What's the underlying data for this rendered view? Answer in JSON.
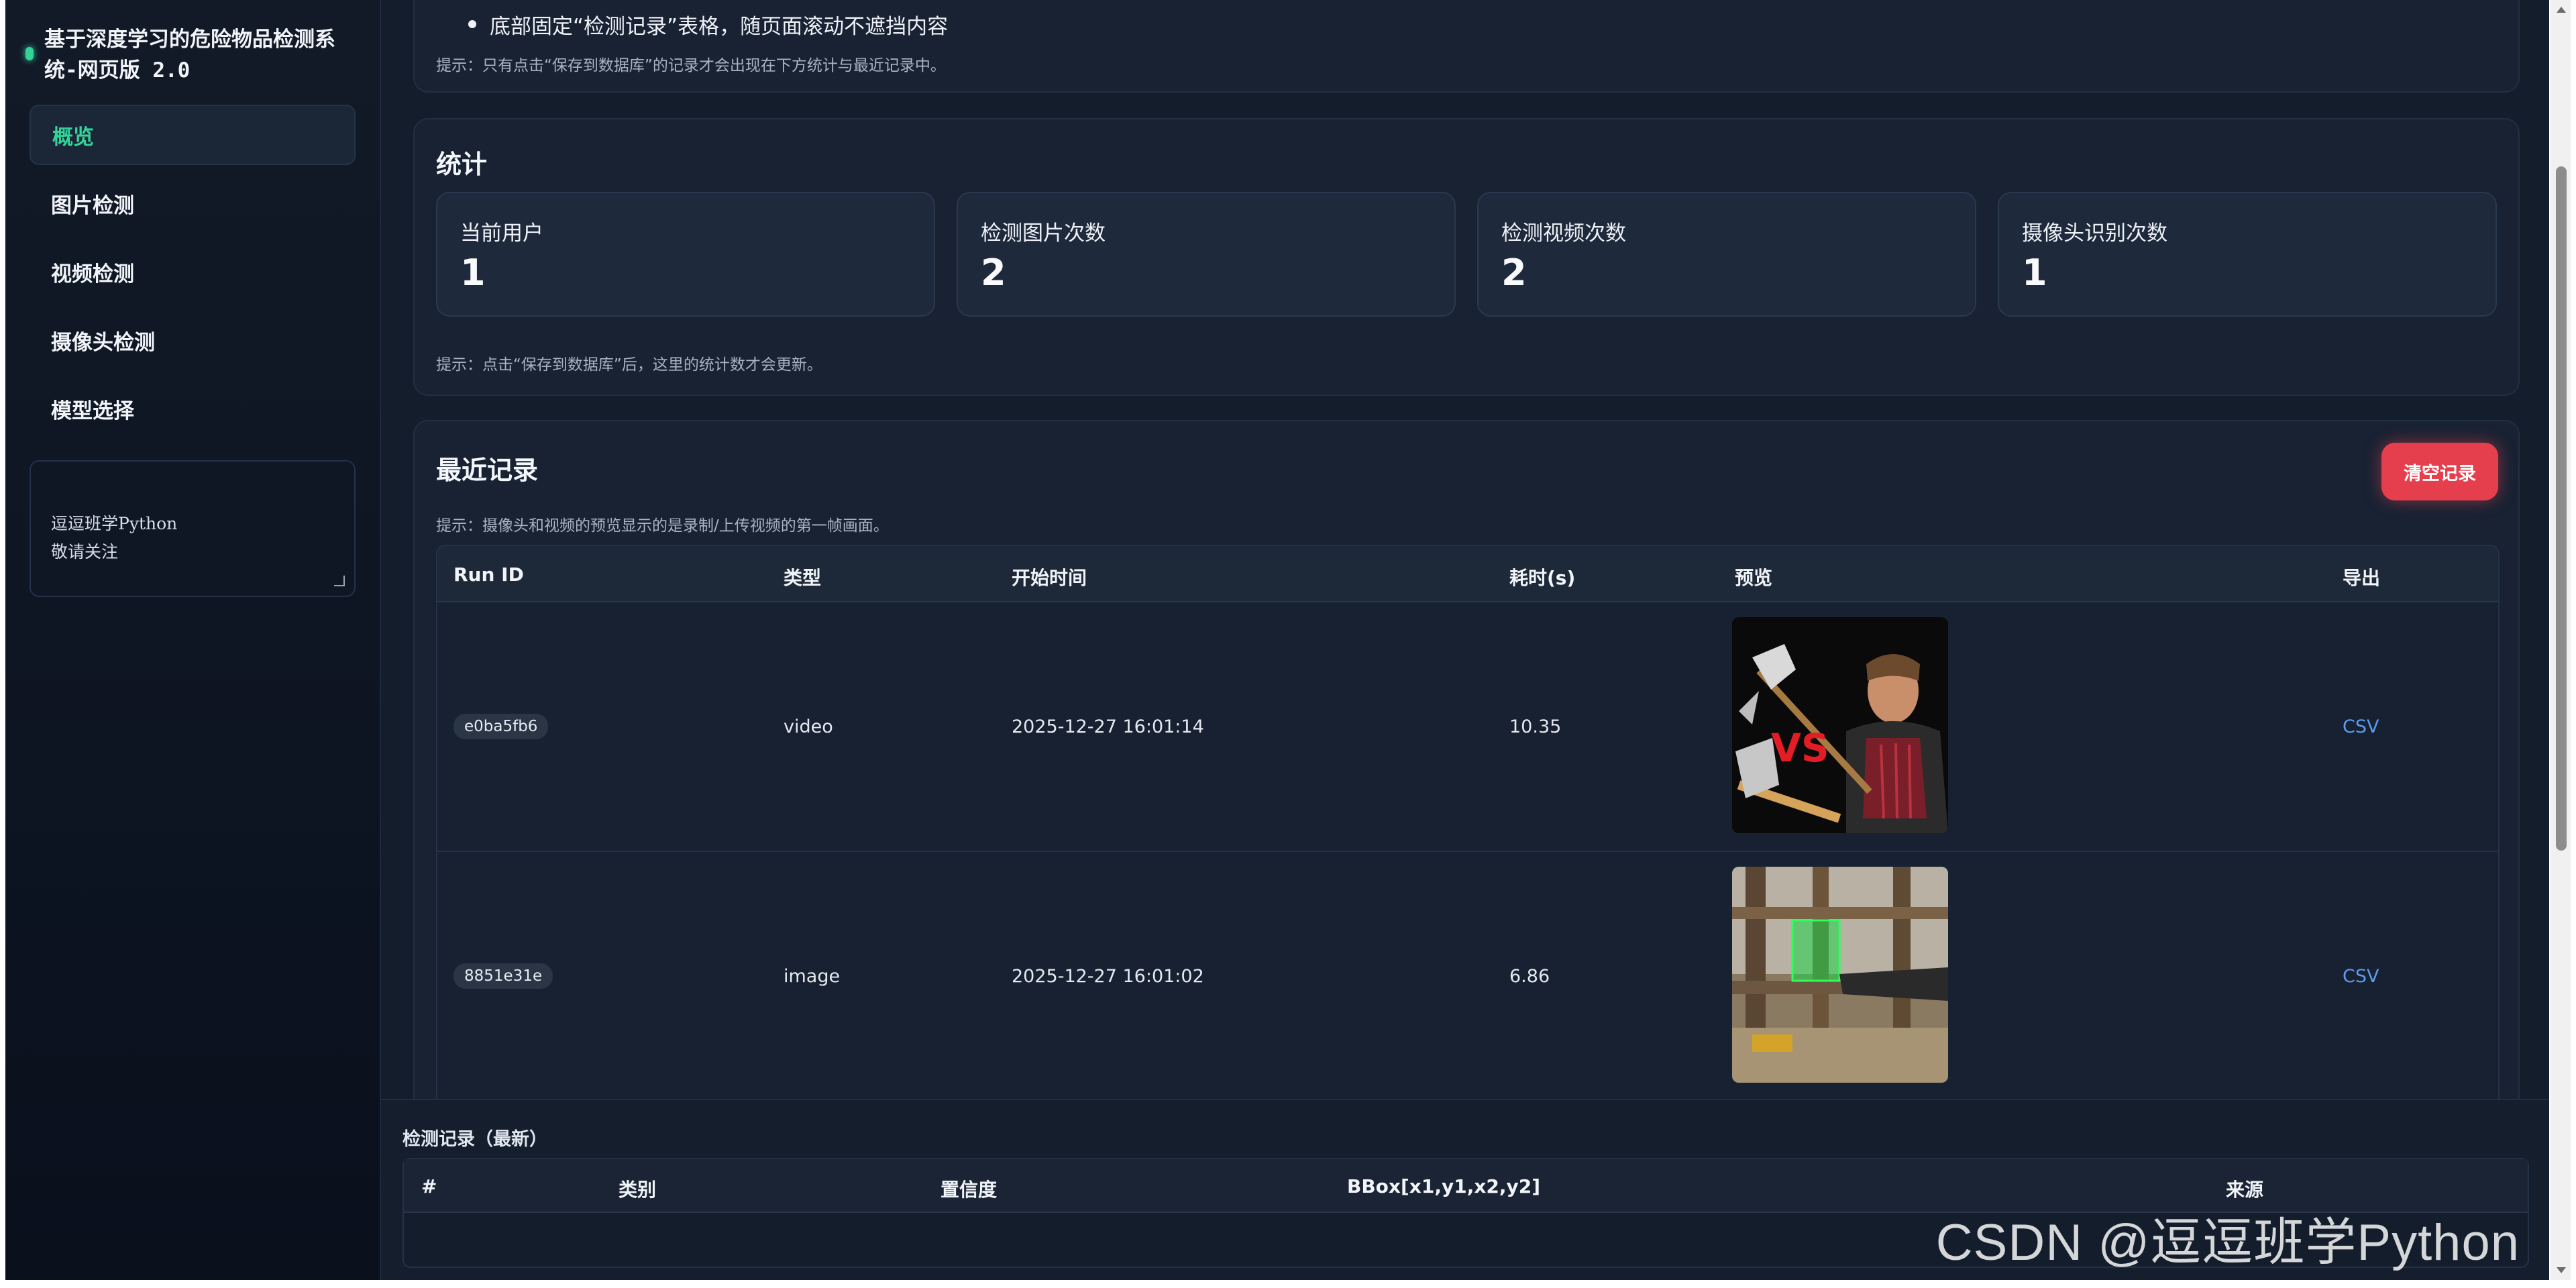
{
  "sidebar": {
    "brand_title": "基于深度学习的危险物品检测系统-网页版 2.0",
    "nav": [
      {
        "label": "概览",
        "active": true
      },
      {
        "label": "图片检测",
        "active": false
      },
      {
        "label": "视频检测",
        "active": false
      },
      {
        "label": "摄像头检测",
        "active": false
      },
      {
        "label": "模型选择",
        "active": false
      }
    ],
    "note_text": "逗逗班学Python\n敬请关注"
  },
  "intro": {
    "bullet": "底部固定“检测记录”表格，随页面滚动不遮挡内容",
    "hint": "提示：只有点击“保存到数据库”的记录才会出现在下方统计与最近记录中。"
  },
  "stats": {
    "title": "统计",
    "cards": [
      {
        "label": "当前用户",
        "value": "1"
      },
      {
        "label": "检测图片次数",
        "value": "2"
      },
      {
        "label": "检测视频次数",
        "value": "2"
      },
      {
        "label": "摄像头识别次数",
        "value": "1"
      }
    ],
    "hint": "提示：点击“保存到数据库”后，这里的统计数才会更新。"
  },
  "recent": {
    "title": "最近记录",
    "clear_label": "清空记录",
    "hint": "提示：摄像头和视频的预览显示的是录制/上传视频的第一帧画面。",
    "columns": [
      "Run ID",
      "类型",
      "开始时间",
      "耗时(s)",
      "预览",
      "导出"
    ],
    "rows": [
      {
        "run_id": "e0ba5fb6",
        "type": "video",
        "start": "2025-12-27 16:01:14",
        "duration": "10.35",
        "export": "CSV",
        "preview_text": "VS"
      },
      {
        "run_id": "8851e31e",
        "type": "image",
        "start": "2025-12-27 16:01:02",
        "duration": "6.86",
        "export": "CSV"
      }
    ]
  },
  "bottom": {
    "title": "检测记录（最新）",
    "columns": [
      "#",
      "类别",
      "置信度",
      "BBox[x1,y1,x2,y2]",
      "来源"
    ]
  },
  "watermark": "CSDN @逗逗班学Python",
  "colors": {
    "accent": "#34d399",
    "danger": "#e53e4d",
    "link": "#5b9bf0"
  }
}
